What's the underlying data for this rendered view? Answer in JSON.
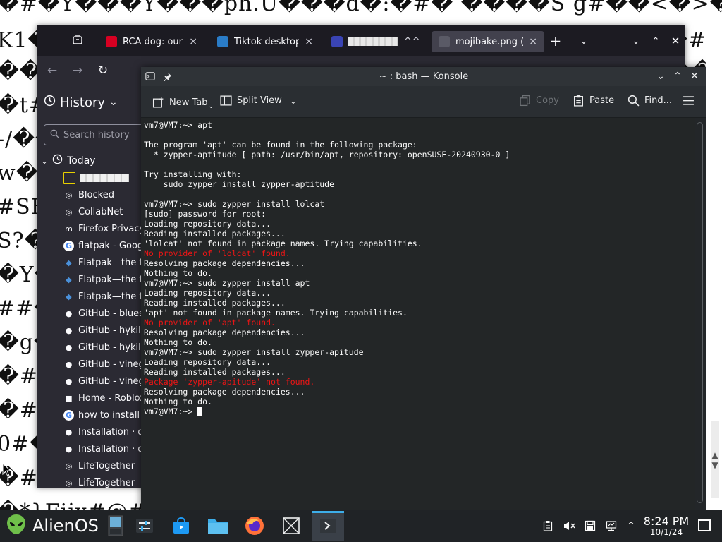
{
  "wallpaper": {
    "lines": [
      "�#�Y���Y���ph.U���d�:�#� ����S g#��<�>�P�D�#�",
      "K1�#�P�#$�C����#��0_ꊜ#�@#�v��#��$�!�#Y2k",
      "�����������������������������������������#",
      "�t#�!?@�#�$Y@#�j�@##�%��#�@#�#��#�%��w�#�%",
      "-/��������������������������������������#�",
      "w���SB#��##@�Y�#��##��#@���#�%Y�##��#@%",
      "#SB��#�%@#��#�����#��#$��#@�#�#�#%@#@�#",
      "S?�#�@#%�#@#��#�#��#�%@##�%��#�@#��#�#",
      "�Y�#�#�#@#%@#�#�##��#@�#%@##@�##�%��#�",
      "##�#@%�#�����#@##���#%@#�##�#@#�%��#�",
      "�g���#@��#@##%�#�@#�%##@#@#��#@�#�#",
      "�##@#�#@����#@###%@#�#�#@##�#%@#�#%",
      "�#@#%@#�##@#�##�#@��#@%#@#�##�#@#",
      "0#��#@###%��#@#�#�#@#�%��#@###%@#�",
      "�#r@#�#%�#@#��#@%#@#�##@#�#%@#�#",
      "�*}Fijx#@#�#@%#@�##@#�#%@##@#�9"
    ]
  },
  "firefox": {
    "tabs": [
      {
        "title": "RCA dog: our fa",
        "close": "×",
        "color": "#d70022"
      },
      {
        "title": "Tiktok desktop a",
        "close": "×",
        "color": "#2a7cc7"
      },
      {
        "title": "",
        "close": "^^",
        "color": "#3a44b4"
      },
      {
        "title": "mojibake.png (PNG",
        "close": "×",
        "color": "#5a5a66"
      }
    ],
    "new_tab": "+",
    "sidebar": {
      "title": "History",
      "title_caret": "⌄",
      "search_placeholder": "Search history",
      "group": "Today",
      "items": [
        {
          "label": "",
          "icon": "blank-page-icon",
          "color": "#e8d000"
        },
        {
          "label": "Blocked",
          "icon": "globe-icon",
          "color": "#fbfbfe"
        },
        {
          "label": "CollabNet",
          "icon": "globe-icon",
          "color": "#fbfbfe"
        },
        {
          "label": "Firefox Privacy",
          "icon": "mozilla-icon",
          "color": "#fbfbfe"
        },
        {
          "label": "flatpak - Goog",
          "icon": "google-icon",
          "color": "#4285f4"
        },
        {
          "label": "Flatpak—the f",
          "icon": "flatpak-icon",
          "color": "#4a90d9"
        },
        {
          "label": "Flatpak—the f",
          "icon": "flatpak-icon",
          "color": "#4a90d9"
        },
        {
          "label": "Flatpak—the f",
          "icon": "flatpak-icon",
          "color": "#4a90d9"
        },
        {
          "label": "GitHub - blues",
          "icon": "github-icon",
          "color": "#fbfbfe"
        },
        {
          "label": "GitHub - hykilp",
          "icon": "github-icon",
          "color": "#fbfbfe"
        },
        {
          "label": "GitHub - hykilp",
          "icon": "github-icon",
          "color": "#fbfbfe"
        },
        {
          "label": "GitHub - vineg",
          "icon": "github-icon",
          "color": "#fbfbfe"
        },
        {
          "label": "GitHub - vineg",
          "icon": "github-icon",
          "color": "#fbfbfe"
        },
        {
          "label": "Home - Roblox",
          "icon": "roblox-icon",
          "color": "#fbfbfe"
        },
        {
          "label": "how to install",
          "icon": "google-icon",
          "color": "#4285f4"
        },
        {
          "label": "Installation · d",
          "icon": "github-icon",
          "color": "#fbfbfe"
        },
        {
          "label": "Installation · d",
          "icon": "github-icon",
          "color": "#fbfbfe"
        },
        {
          "label": "LifeTogether",
          "icon": "globe-icon",
          "color": "#fbfbfe"
        },
        {
          "label": "LifeTogether",
          "icon": "globe-icon",
          "color": "#fbfbfe"
        }
      ]
    }
  },
  "konsole": {
    "title": "~ : bash — Konsole",
    "toolbar": {
      "new_tab": "New Tab",
      "split_view": "Split View",
      "copy": "Copy",
      "paste": "Paste",
      "find": "Find..."
    },
    "terminal_lines": [
      {
        "text": "vm7@VM7:~> apt",
        "type": "normal"
      },
      {
        "text": "",
        "type": "normal"
      },
      {
        "text": "The program 'apt' can be found in the following package:",
        "type": "normal"
      },
      {
        "text": "  * zypper-aptitude [ path: /usr/bin/apt, repository: openSUSE-20240930-0 ]",
        "type": "normal"
      },
      {
        "text": "",
        "type": "normal"
      },
      {
        "text": "Try installing with:",
        "type": "normal"
      },
      {
        "text": "    sudo zypper install zypper-aptitude",
        "type": "normal"
      },
      {
        "text": "",
        "type": "normal"
      },
      {
        "text": "vm7@VM7:~> sudo zypper install lolcat",
        "type": "normal"
      },
      {
        "text": "[sudo] password for root:",
        "type": "normal"
      },
      {
        "text": "Loading repository data...",
        "type": "normal"
      },
      {
        "text": "Reading installed packages...",
        "type": "normal"
      },
      {
        "text": "'lolcat' not found in package names. Trying capabilities.",
        "type": "normal"
      },
      {
        "text": "No provider of 'lolcat' found.",
        "type": "err"
      },
      {
        "text": "Resolving package dependencies...",
        "type": "normal"
      },
      {
        "text": "Nothing to do.",
        "type": "normal"
      },
      {
        "text": "vm7@VM7:~> sudo zypper install apt",
        "type": "normal"
      },
      {
        "text": "Loading repository data...",
        "type": "normal"
      },
      {
        "text": "Reading installed packages...",
        "type": "normal"
      },
      {
        "text": "'apt' not found in package names. Trying capabilities.",
        "type": "normal"
      },
      {
        "text": "No provider of 'apt' found.",
        "type": "err"
      },
      {
        "text": "Resolving package dependencies...",
        "type": "normal"
      },
      {
        "text": "Nothing to do.",
        "type": "normal"
      },
      {
        "text": "vm7@VM7:~> sudo zypper install zypper-apitude",
        "type": "normal"
      },
      {
        "text": "Loading repository data...",
        "type": "normal"
      },
      {
        "text": "Reading installed packages...",
        "type": "normal"
      },
      {
        "text": "Package 'zypper-apitude' not found.",
        "type": "err"
      },
      {
        "text": "Resolving package dependencies...",
        "type": "normal"
      },
      {
        "text": "Nothing to do.",
        "type": "normal"
      },
      {
        "text": "vm7@VM7:~> ",
        "type": "prompt"
      }
    ]
  },
  "taskbar": {
    "start_label": "AlienOS",
    "clock_time": "8:24 PM",
    "clock_date": "10/1/24",
    "colors": {
      "accent": "#3daee9",
      "panel": "#202326"
    }
  }
}
